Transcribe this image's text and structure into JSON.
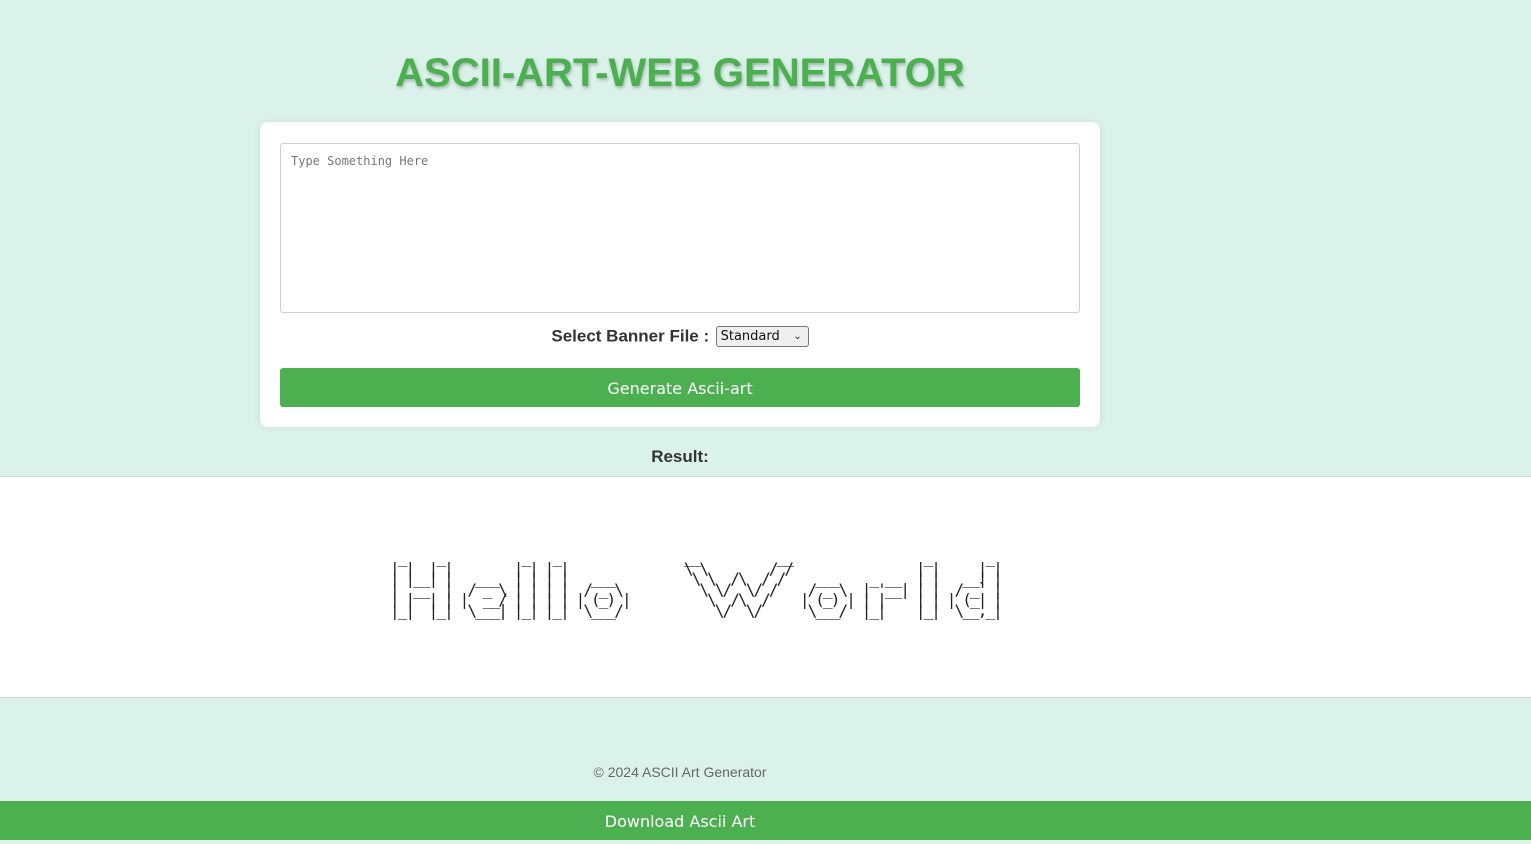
{
  "page": {
    "title": "ASCII-ART-WEB GENERATOR"
  },
  "form": {
    "text_input": {
      "value": "",
      "placeholder": "Type Something Here"
    },
    "banner_label": "Select Banner File :",
    "banner_select": {
      "selected": "Standard"
    },
    "generate_label": "Generate Ascii-art"
  },
  "result": {
    "label": "Result:",
    "ascii_art": " _    _          _   _                __          __                 _       _ \n| |  | |        | | | |               \\ \\        / /                | |     | |\n| |__| |   ___  | | | |   ___          \\ \\  /\\  / /    ___    _ __  | |   __| |\n|  __  |  / _ \\ | | | |  / _ \\          \\ \\/  \\/ /    / _ \\  | '__| | |  / _` |\n| |  | | |  __/ | | | | | (_) |          \\  /\\  /    | (_) | | |    | | | (_| |\n|_|  |_|  \\___| |_| |_|  \\___/            \\/  \\/      \\___/  |_|    |_|  \\__,_|\n                                                                               \n                                                                               "
  },
  "footer": {
    "copyright": "© 2024 ASCII Art Generator"
  },
  "download": {
    "label": "Download Ascii Art"
  },
  "colors": {
    "background": "#daf2ea",
    "accent": "#4caf50",
    "card": "#ffffff"
  }
}
